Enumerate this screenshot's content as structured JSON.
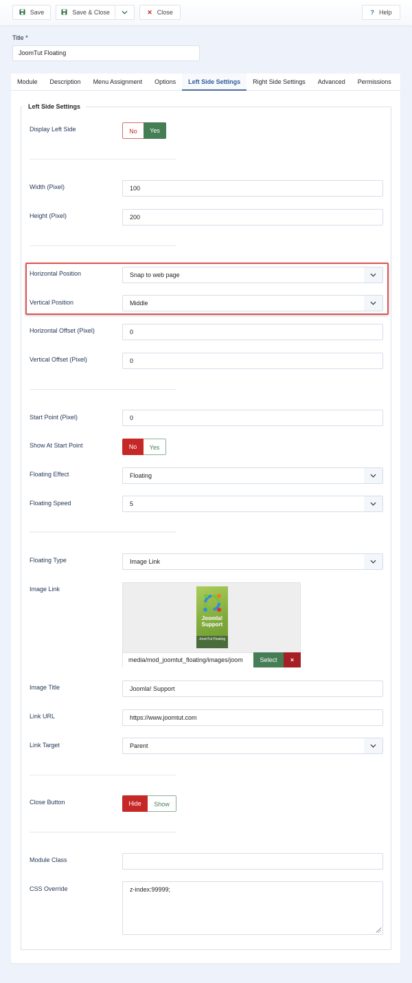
{
  "toolbar": {
    "save": "Save",
    "save_close": "Save & Close",
    "close": "Close",
    "help": "Help",
    "icons": {
      "save": "floppy-disk",
      "dropdown": "chevron-down",
      "close": "x-mark",
      "help": "question-mark"
    }
  },
  "title": {
    "label": "Title *",
    "value": "JoomTut Floating"
  },
  "tabs": [
    {
      "label": "Module",
      "active": false
    },
    {
      "label": "Description",
      "active": false
    },
    {
      "label": "Menu Assignment",
      "active": false
    },
    {
      "label": "Options",
      "active": false
    },
    {
      "label": "Left Side Settings",
      "active": true
    },
    {
      "label": "Right Side Settings",
      "active": false
    },
    {
      "label": "Advanced",
      "active": false
    },
    {
      "label": "Permissions",
      "active": false
    }
  ],
  "fieldset": {
    "legend": "Left Side Settings",
    "display_left_side": {
      "label": "Display Left Side",
      "options": [
        "No",
        "Yes"
      ],
      "selected": "Yes"
    },
    "width": {
      "label": "Width (Pixel)",
      "value": "100"
    },
    "height": {
      "label": "Height (Pixel)",
      "value": "200"
    },
    "horizontal_position": {
      "label": "Horizontal Position",
      "value": "Snap to web page"
    },
    "vertical_position": {
      "label": "Vertical Position",
      "value": "Middle"
    },
    "horizontal_offset": {
      "label": "Horizontal Offset (Pixel)",
      "value": "0"
    },
    "vertical_offset": {
      "label": "Vertical Offset (Pixel)",
      "value": "0"
    },
    "start_point": {
      "label": "Start Point (Pixel)",
      "value": "0"
    },
    "show_at_start_point": {
      "label": "Show At Start Point",
      "options": [
        "No",
        "Yes"
      ],
      "selected": "No"
    },
    "floating_effect": {
      "label": "Floating Effect",
      "value": "Floating"
    },
    "floating_speed": {
      "label": "Floating Speed",
      "value": "5"
    },
    "floating_type": {
      "label": "Floating Type",
      "value": "Image Link"
    },
    "image_link": {
      "label": "Image Link",
      "preview_text": "Joomla! Support",
      "preview_caption": "JoomTut Floating",
      "path": "media/mod_joomtut_floating/images/joom",
      "select_label": "Select",
      "clear_label": "×"
    },
    "image_title": {
      "label": "Image Title",
      "value": "Joomla! Support"
    },
    "link_url": {
      "label": "Link URL",
      "value": "https://www.joomtut.com"
    },
    "link_target": {
      "label": "Link Target",
      "value": "Parent"
    },
    "close_button": {
      "label": "Close Button",
      "options": [
        "Hide",
        "Show"
      ],
      "selected": "Hide"
    },
    "module_class": {
      "label": "Module Class",
      "value": ""
    },
    "css_override": {
      "label": "CSS Override",
      "value": "z-index:99999;"
    }
  },
  "colors": {
    "accent_green": "#457d54",
    "accent_red": "#c52827",
    "active_tab": "#2e5c9b",
    "highlight_border": "#e05252",
    "page_bg": "#eef2fa"
  }
}
